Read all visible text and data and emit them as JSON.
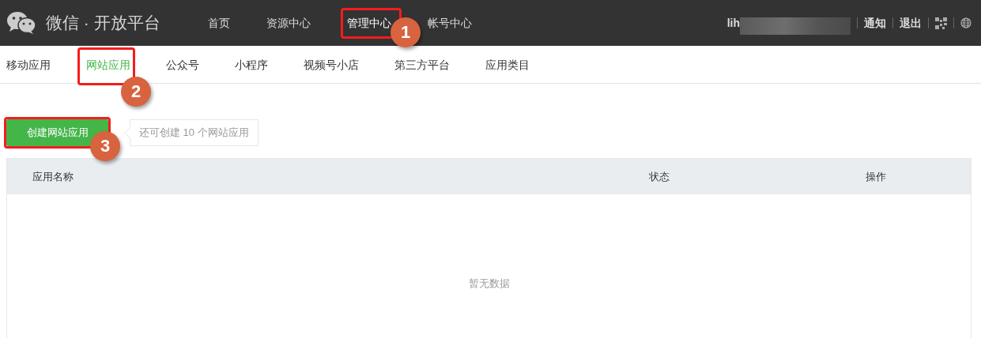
{
  "header": {
    "title": "微信 · 开放平台",
    "nav": [
      {
        "label": "首页",
        "selected": false
      },
      {
        "label": "资源中心",
        "selected": false
      },
      {
        "label": "管理中心",
        "selected": true,
        "callout": "1"
      },
      {
        "label": "帐号中心",
        "selected": false
      }
    ],
    "user": "lih",
    "links": [
      "通知",
      "退出"
    ]
  },
  "subnav": [
    {
      "label": "移动应用",
      "selected": false
    },
    {
      "label": "网站应用",
      "selected": true,
      "callout": "2"
    },
    {
      "label": "公众号",
      "selected": false
    },
    {
      "label": "小程序",
      "selected": false
    },
    {
      "label": "视频号小店",
      "selected": false
    },
    {
      "label": "第三方平台",
      "selected": false
    },
    {
      "label": "应用类目",
      "selected": false
    }
  ],
  "create_button": {
    "label": "创建网站应用",
    "callout": "3"
  },
  "quota_hint": "还可创建 10 个网站应用",
  "table": {
    "columns": [
      "应用名称",
      "状态",
      "操作"
    ],
    "empty_text": "暂无数据"
  }
}
